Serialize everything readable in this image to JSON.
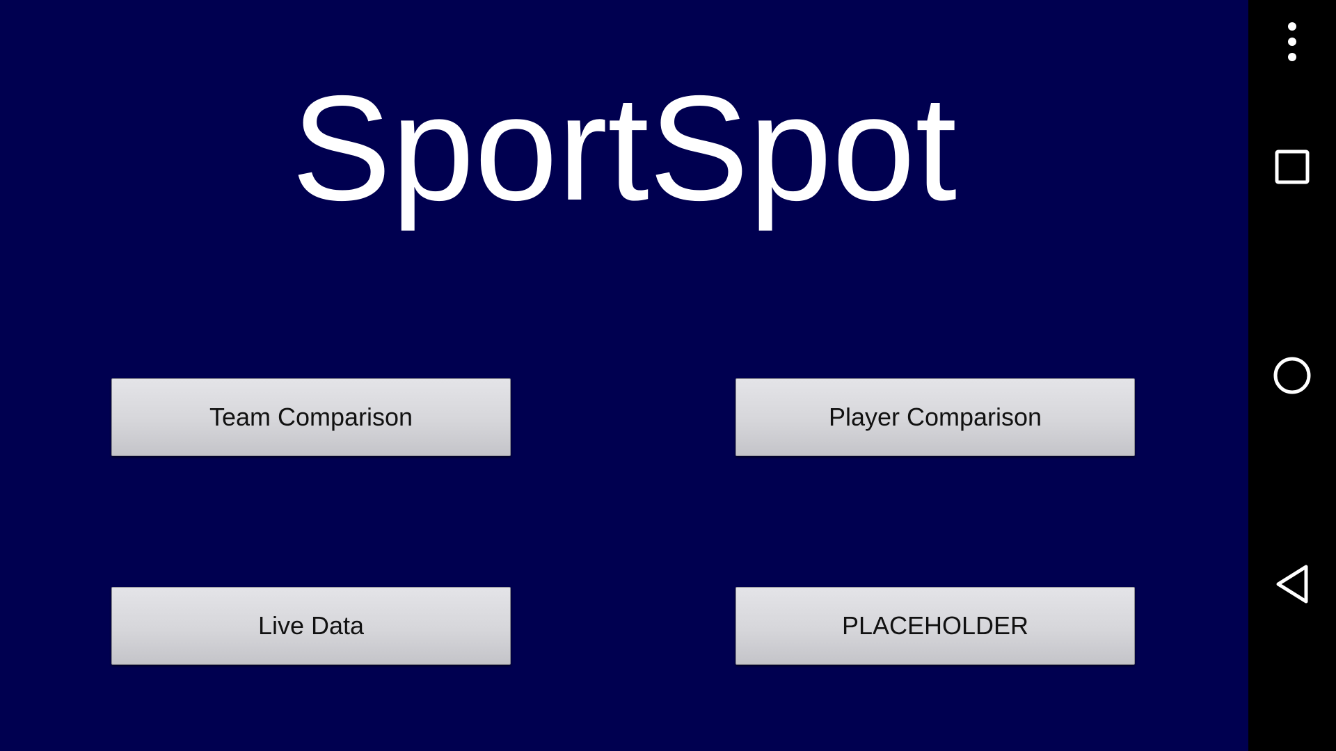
{
  "app": {
    "title": "SportSpot",
    "background_color": "#000050",
    "title_color": "#ffffff"
  },
  "menu": {
    "buttons": [
      {
        "label": "Team Comparison"
      },
      {
        "label": "Player Comparison"
      },
      {
        "label": "Live Data"
      },
      {
        "label": "PLACEHOLDER"
      }
    ]
  },
  "navigation_bar": {
    "background_color": "#000000",
    "icons": [
      "overflow-menu-icon",
      "recents-icon",
      "home-icon",
      "back-icon"
    ]
  }
}
